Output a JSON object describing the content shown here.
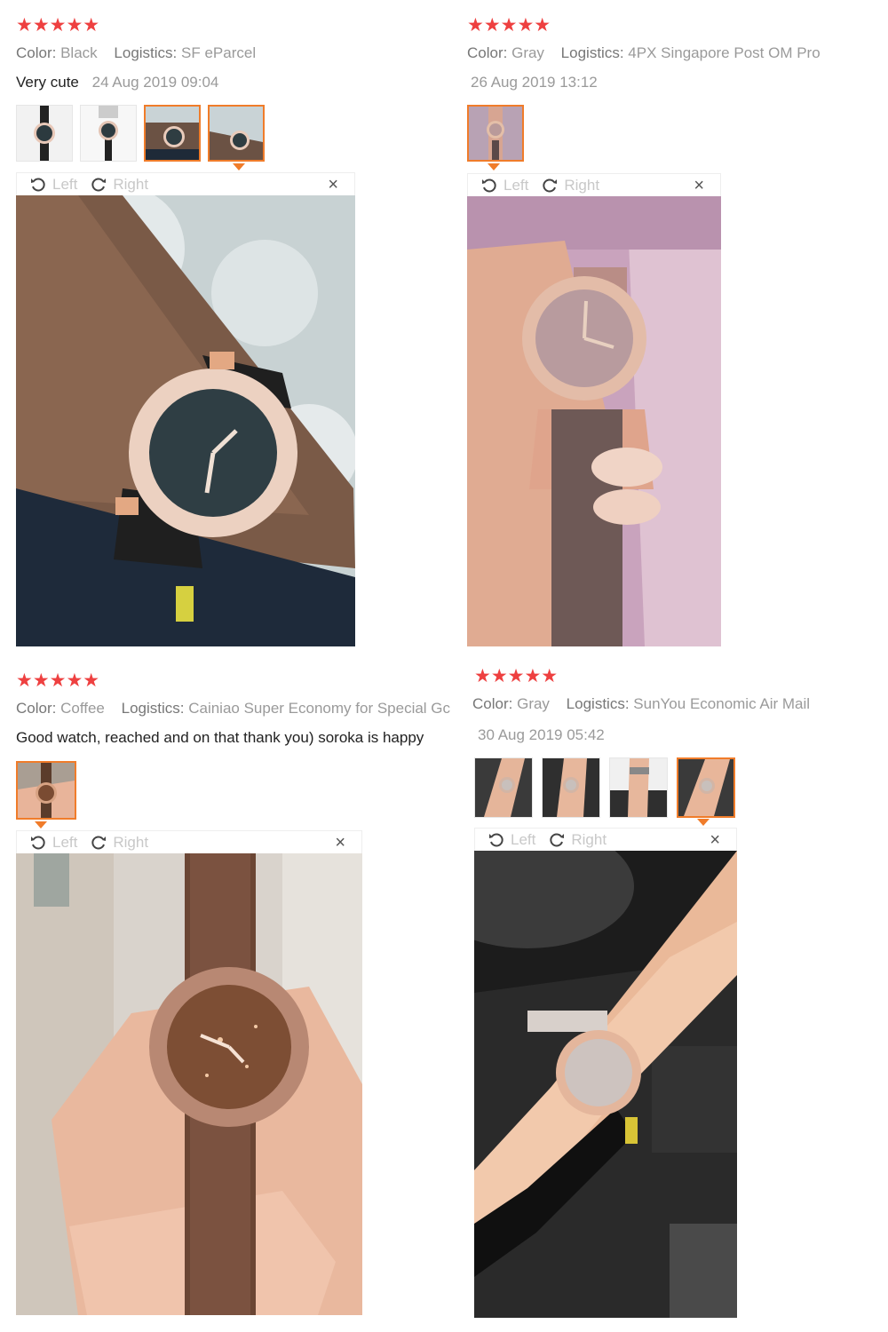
{
  "reviews": [
    {
      "stars": "★★★★★",
      "color_label": "Color:",
      "color_value": "Black",
      "logistics_label": "Logistics:",
      "logistics_value": "SF eParcel",
      "text": "Very cute",
      "date": "24 Aug 2019 09:04",
      "toolbar": {
        "left": "Left",
        "right": "Right",
        "close": "×"
      }
    },
    {
      "stars": "★★★★★",
      "color_label": "Color:",
      "color_value": "Gray",
      "logistics_label": "Logistics:",
      "logistics_value": "4PX Singapore Post OM Pro",
      "text": "",
      "date": "26 Aug 2019 13:12",
      "toolbar": {
        "left": "Left",
        "right": "Right",
        "close": "×"
      }
    },
    {
      "stars": "★★★★★",
      "color_label": "Color:",
      "color_value": "Coffee",
      "logistics_label": "Logistics:",
      "logistics_value": "Cainiao Super Economy for Special Gc",
      "text": "Good watch, reached and on that thank you) soroka is happy",
      "date": "",
      "toolbar": {
        "left": "Left",
        "right": "Right",
        "close": "×"
      }
    },
    {
      "stars": "★★★★★",
      "color_label": "Color:",
      "color_value": "Gray",
      "logistics_label": "Logistics:",
      "logistics_value": "SunYou Economic Air Mail",
      "text": "",
      "date": "30 Aug 2019 05:42",
      "toolbar": {
        "left": "Left",
        "right": "Right",
        "close": "×"
      }
    }
  ],
  "colors": {
    "star": "#ee4040",
    "thumb_active_border": "#f07c2a",
    "muted_text": "#9a9a9a"
  },
  "icons": [
    "rotate-left-icon",
    "rotate-right-icon",
    "close-icon"
  ]
}
